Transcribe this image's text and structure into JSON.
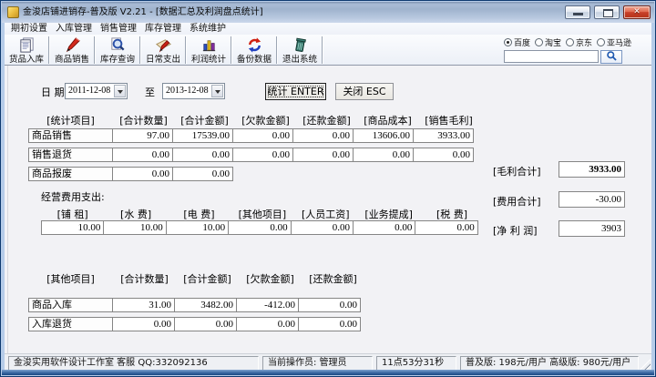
{
  "window": {
    "title": "金浚店铺进销存-普及版 V2.21 - [数据汇总及利润盘点统计]"
  },
  "colors": {
    "frame_blue": "#16437e",
    "titlebar_blue": "#a9bcd6",
    "close_red": "#b43318",
    "search_accent": "#1e58b0"
  },
  "menu": {
    "items": [
      {
        "label": "期初设置"
      },
      {
        "label": "入库管理"
      },
      {
        "label": "销售管理"
      },
      {
        "label": "库存管理"
      },
      {
        "label": "系统维护"
      }
    ]
  },
  "toolbar": {
    "buttons": [
      {
        "label": "货品入库",
        "icon": "notepad-icon"
      },
      {
        "label": "商品销售",
        "icon": "pencil-icon"
      },
      {
        "label": "库存查询",
        "icon": "magnifier-icon"
      },
      {
        "label": "日常支出",
        "icon": "expense-card-icon"
      },
      {
        "label": "利润统计",
        "icon": "bar-chart-icon"
      },
      {
        "label": "备份数据",
        "icon": "sync-arrows-icon"
      },
      {
        "label": "退出系统",
        "icon": "trash-icon"
      }
    ],
    "search": {
      "engines": [
        {
          "label": "百度",
          "selected": true
        },
        {
          "label": "淘宝",
          "selected": false
        },
        {
          "label": "京东",
          "selected": false
        },
        {
          "label": "亚马逊",
          "selected": false
        }
      ],
      "input_value": "",
      "button_icon": "search-icon"
    }
  },
  "query": {
    "date_label": "日 期",
    "from_value": "2011-12-08",
    "to_label": "至",
    "to_value": "2013-12-08",
    "stat_button": "统计 ENTER",
    "close_button": "关闭 ESC"
  },
  "summary_table": {
    "headers": [
      "[统计项目]",
      "[合计数量]",
      "[合计金额]",
      "[欠款金额]",
      "[还款金额]",
      "[商品成本]",
      "[销售毛利]"
    ],
    "rows": [
      {
        "label": "商品销售",
        "values": [
          "97.00",
          "17539.00",
          "0.00",
          "0.00",
          "13606.00",
          "3933.00"
        ]
      },
      {
        "label": "销售退货",
        "values": [
          "0.00",
          "0.00",
          "0.00",
          "0.00",
          "0.00",
          "0.00"
        ]
      },
      {
        "label": "商品报废",
        "values": [
          "0.00",
          "0.00"
        ]
      }
    ]
  },
  "totals": {
    "gross_label": "[毛利合计]",
    "gross_value": "3933.00",
    "expense_label": "[费用合计]",
    "expense_value": "-30.00",
    "net_label": "[净 利 润]",
    "net_value": "3903"
  },
  "expenses": {
    "title": "经营费用支出:",
    "headers": [
      "[铺 租]",
      "[水 费]",
      "[电 费]",
      "[其他项目]",
      "[人员工资]",
      "[业务提成]",
      "[税 费]"
    ],
    "values": [
      "10.00",
      "10.00",
      "10.00",
      "0.00",
      "0.00",
      "0.00",
      "0.00"
    ]
  },
  "other_table": {
    "headers": [
      "[其他项目]",
      "[合计数量]",
      "[合计金额]",
      "[欠款金额]",
      "[还款金额]"
    ],
    "rows": [
      {
        "label": "商品入库",
        "values": [
          "31.00",
          "3482.00",
          "-412.00",
          "0.00"
        ]
      },
      {
        "label": "入库退货",
        "values": [
          "0.00",
          "0.00",
          "0.00",
          "0.00"
        ]
      }
    ]
  },
  "statusbar": {
    "panels": [
      "金浚实用软件设计工作室  客服 QQ:332092136",
      "当前操作员: 管理员",
      "11点53分31秒",
      "普及版: 198元/用户  高级版: 980元/用户"
    ]
  }
}
